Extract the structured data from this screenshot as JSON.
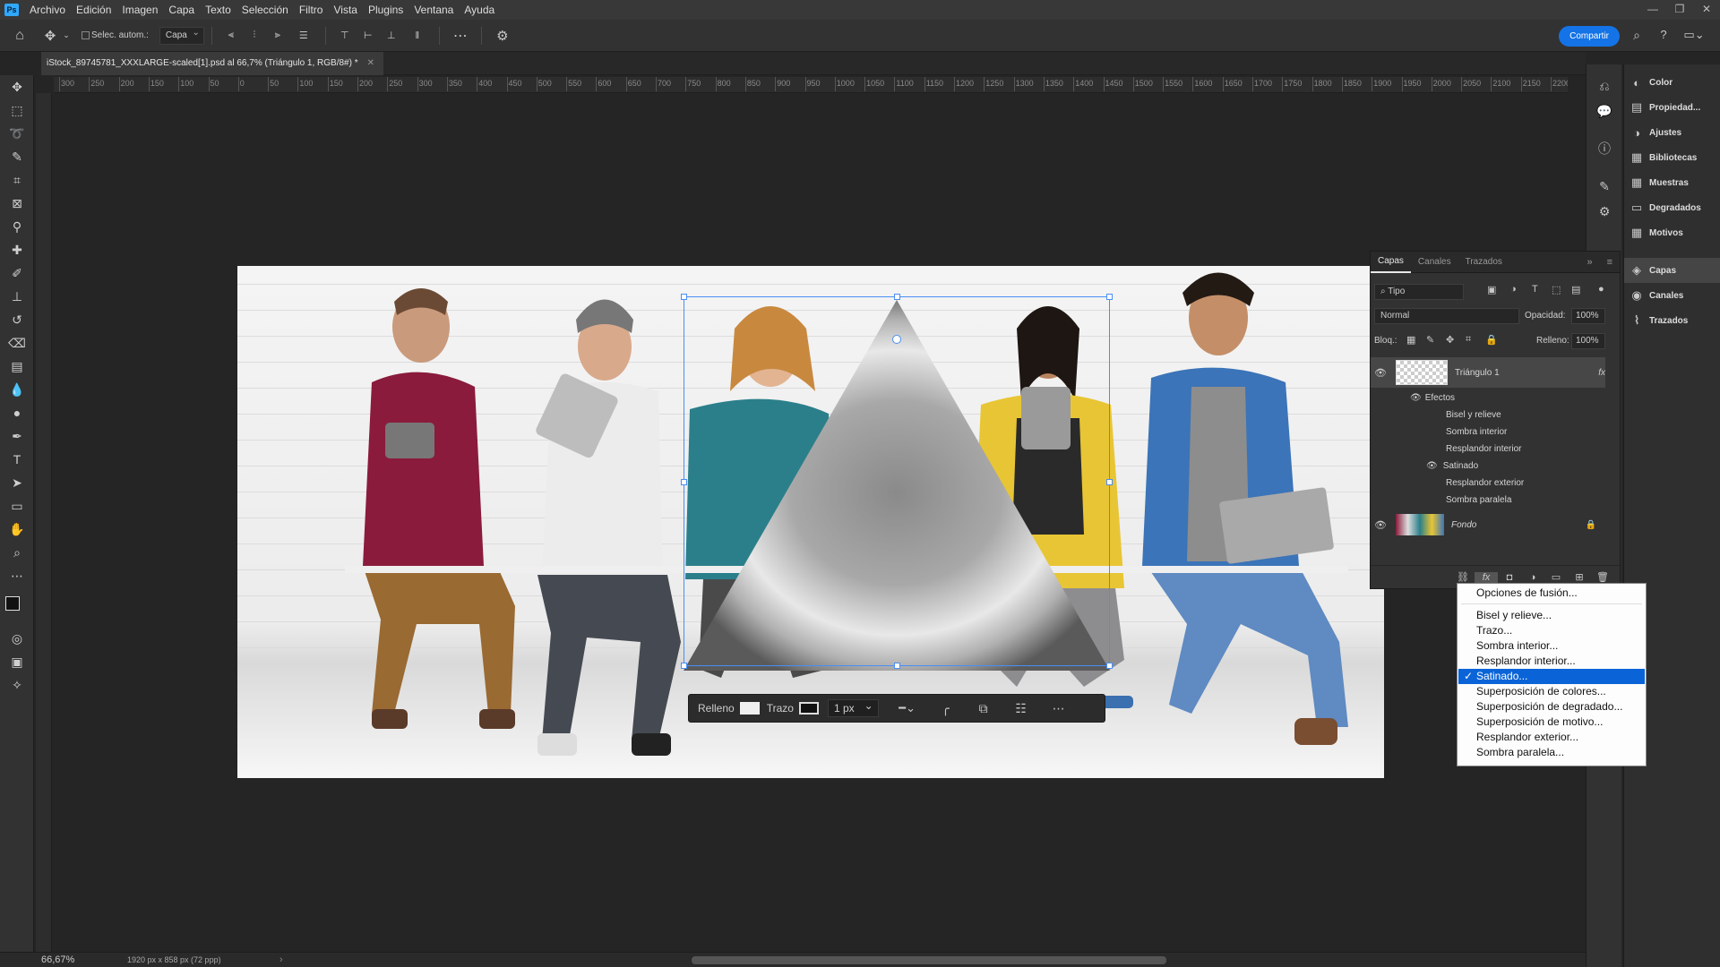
{
  "menubar": {
    "logo": "Ps",
    "items": [
      "Archivo",
      "Edición",
      "Imagen",
      "Capa",
      "Texto",
      "Selección",
      "Filtro",
      "Vista",
      "Plugins",
      "Ventana",
      "Ayuda"
    ]
  },
  "options_bar": {
    "auto_select_label": "Selec. autom.:",
    "auto_select_value": "Capa",
    "share_label": "Compartir"
  },
  "document": {
    "tab_title": "iStock_89745781_XXXLARGE-scaled[1].psd al 66,7% (Triángulo 1, RGB/8#) *"
  },
  "ruler": {
    "ticks": [
      "300",
      "250",
      "200",
      "150",
      "100",
      "50",
      "0",
      "50",
      "100",
      "150",
      "200",
      "250",
      "300",
      "350",
      "400",
      "450",
      "500",
      "550",
      "600",
      "650",
      "700",
      "750",
      "800",
      "850",
      "900",
      "950",
      "1000",
      "1050",
      "1100",
      "1150",
      "1200",
      "1250",
      "1300",
      "1350",
      "1400",
      "1450",
      "1500",
      "1550",
      "1600",
      "1650",
      "1700",
      "1750",
      "1800",
      "1850",
      "1900",
      "1950",
      "2000",
      "2050",
      "2100",
      "2150",
      "2200"
    ]
  },
  "contextual_bar": {
    "fill_label": "Relleno",
    "stroke_label": "Trazo",
    "stroke_width": "1 px"
  },
  "panel_nav": {
    "items": [
      {
        "label": "Color",
        "icon": "color-wheel-icon"
      },
      {
        "label": "Propiedad...",
        "icon": "properties-icon"
      },
      {
        "label": "Ajustes",
        "icon": "adjustments-icon"
      },
      {
        "label": "Bibliotecas",
        "icon": "libraries-icon"
      },
      {
        "label": "Muestras",
        "icon": "swatches-icon"
      },
      {
        "label": "Degradados",
        "icon": "gradients-icon"
      },
      {
        "label": "Motivos",
        "icon": "patterns-icon"
      },
      {
        "label": "Capas",
        "icon": "layers-icon"
      },
      {
        "label": "Canales",
        "icon": "channels-icon"
      },
      {
        "label": "Trazados",
        "icon": "paths-icon"
      }
    ]
  },
  "layers_panel": {
    "tabs": [
      "Capas",
      "Canales",
      "Trazados"
    ],
    "filter_label": "Tipo",
    "blend_mode": "Normal",
    "opacity_label": "Opacidad:",
    "opacity_value": "100%",
    "lock_label": "Bloq.:",
    "fill_label": "Relleno:",
    "fill_value": "100%",
    "layers": [
      {
        "name": "Triángulo 1",
        "fx": "fx",
        "effects_header": "Efectos",
        "effects": [
          "Bisel y relieve",
          "Sombra interior",
          "Resplandor interior",
          "Satinado",
          "Resplandor exterior",
          "Sombra paralela"
        ]
      },
      {
        "name": "Fondo"
      }
    ]
  },
  "fx_menu": {
    "items": [
      "Opciones de fusión...",
      "Bisel y relieve...",
      "Trazo...",
      "Sombra interior...",
      "Resplandor interior...",
      "Satinado...",
      "Superposición de colores...",
      "Superposición de degradado...",
      "Superposición de motivo...",
      "Resplandor exterior...",
      "Sombra paralela..."
    ],
    "selected_index": 5
  },
  "status_bar": {
    "zoom": "66,67%",
    "doc_info": "1920 px x 858 px (72 ppp)"
  }
}
